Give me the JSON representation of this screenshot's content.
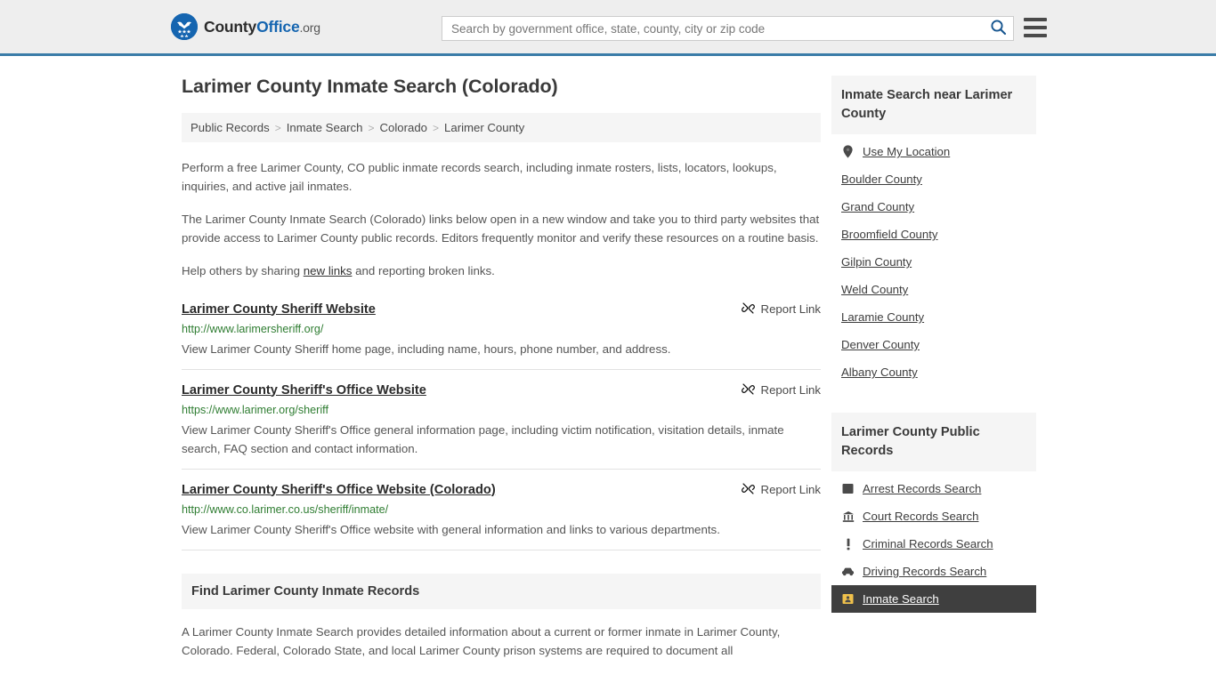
{
  "header": {
    "logo": {
      "text_part1": "County",
      "text_part2": "Office",
      "tld": ".org",
      "icon": "eagle-seal-logo-icon"
    },
    "search": {
      "placeholder": "Search by government office, state, county, city or zip code",
      "value": "",
      "search_icon": "search-icon"
    },
    "menu_icon": "hamburger-menu-icon",
    "accent_color": "#3a7ca8"
  },
  "page": {
    "title": "Larimer County Inmate Search (Colorado)"
  },
  "breadcrumb": {
    "separator": ">",
    "items": [
      {
        "label": "Public Records"
      },
      {
        "label": "Inmate Search"
      },
      {
        "label": "Colorado"
      },
      {
        "label": "Larimer County"
      }
    ]
  },
  "intro": {
    "p1": "Perform a free Larimer County, CO public inmate records search, including inmate rosters, lists, locators, lookups, inquiries, and active jail inmates.",
    "p2": "The Larimer County Inmate Search (Colorado) links below open in a new window and take you to third party websites that provide access to Larimer County public records. Editors frequently monitor and verify these resources on a routine basis.",
    "p3_before": "Help others by sharing ",
    "p3_link": "new links",
    "p3_after": " and reporting broken links."
  },
  "results": {
    "report_label": "Report Link",
    "report_icon": "broken-link-icon",
    "items": [
      {
        "title": "Larimer County Sheriff Website",
        "url": "http://www.larimersheriff.org/",
        "description": "View Larimer County Sheriff home page, including name, hours, phone number, and address."
      },
      {
        "title": "Larimer County Sheriff's Office Website",
        "url": "https://www.larimer.org/sheriff",
        "description": "View Larimer County Sheriff's Office general information page, including victim notification, visitation details, inmate search, FAQ section and contact information."
      },
      {
        "title": "Larimer County Sheriff's Office Website (Colorado)",
        "url": "http://www.co.larimer.co.us/sheriff/inmate/",
        "description": "View Larimer County Sheriff's Office website with general information and links to various departments."
      }
    ]
  },
  "find_section": {
    "heading": "Find Larimer County Inmate Records",
    "body": "A Larimer County Inmate Search provides detailed information about a current or former inmate in Larimer County, Colorado. Federal, Colorado State, and local Larimer County prison systems are required to document all"
  },
  "sidebar": {
    "nearby": {
      "heading": "Inmate Search near Larimer County",
      "items": [
        {
          "label": "Use My Location",
          "icon": "map-pin-icon"
        },
        {
          "label": "Boulder County",
          "icon": ""
        },
        {
          "label": "Grand County",
          "icon": ""
        },
        {
          "label": "Broomfield County",
          "icon": ""
        },
        {
          "label": "Gilpin County",
          "icon": ""
        },
        {
          "label": "Weld County",
          "icon": ""
        },
        {
          "label": "Laramie County",
          "icon": ""
        },
        {
          "label": "Denver County",
          "icon": ""
        },
        {
          "label": "Albany County",
          "icon": ""
        }
      ]
    },
    "public_records": {
      "heading": "Larimer County Public Records",
      "items": [
        {
          "label": "Arrest Records Search",
          "icon": "square-badge-icon",
          "active": false
        },
        {
          "label": "Court Records Search",
          "icon": "courthouse-icon",
          "active": false
        },
        {
          "label": "Criminal Records Search",
          "icon": "exclamation-icon",
          "active": false
        },
        {
          "label": "Driving Records Search",
          "icon": "car-icon",
          "active": false
        },
        {
          "label": "Inmate Search",
          "icon": "inmate-icon",
          "active": true
        }
      ]
    }
  }
}
